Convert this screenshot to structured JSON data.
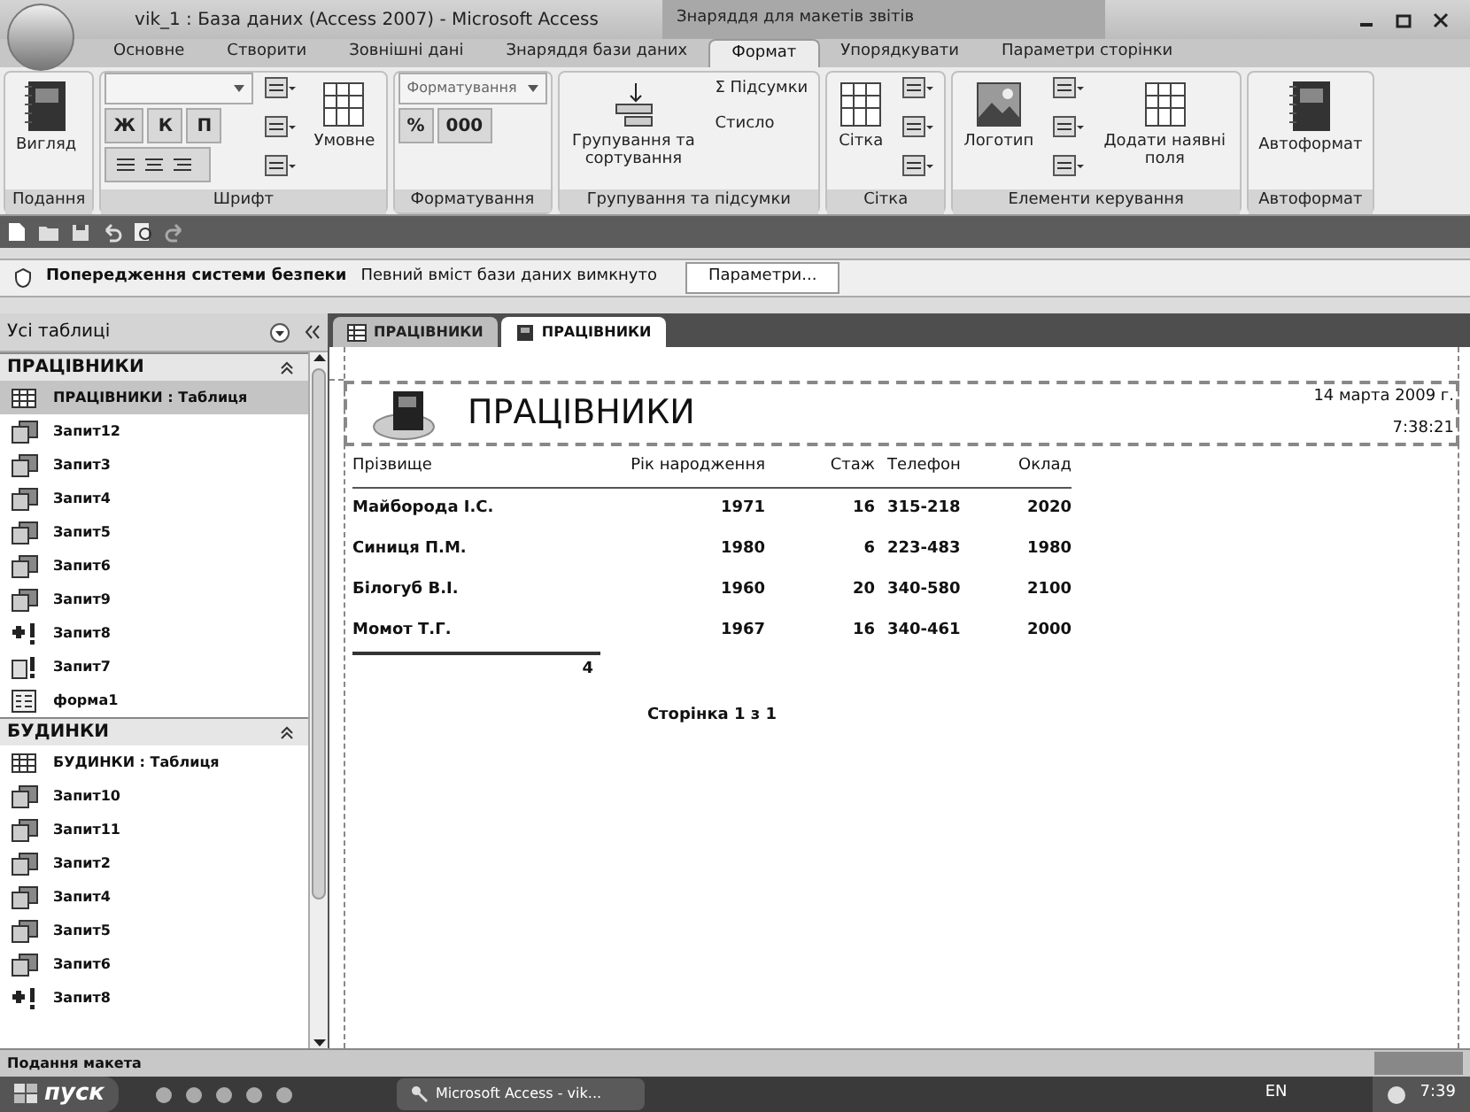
{
  "window": {
    "title": "vik_1 : База даних (Access 2007) - Microsoft Access",
    "context_tab": "Знаряддя для макетів звітів"
  },
  "ribbon_tabs": [
    {
      "label": "Основне",
      "selected": false
    },
    {
      "label": "Створити",
      "selected": false
    },
    {
      "label": "Зовнішні дані",
      "selected": false
    },
    {
      "label": "Знаряддя бази даних",
      "selected": false
    },
    {
      "label": "Формат",
      "selected": true
    },
    {
      "label": "Упорядкувати",
      "selected": false
    },
    {
      "label": "Параметри сторінки",
      "selected": false
    }
  ],
  "ribbon_groups": [
    {
      "label": "Подання",
      "items": [
        {
          "kind": "large",
          "label": "Вигляд"
        }
      ]
    },
    {
      "label": "Шрифт",
      "items": [
        {
          "kind": "combo"
        },
        {
          "kind": "textrow",
          "labels": [
            "Ж",
            "К",
            "П"
          ]
        },
        {
          "kind": "iconrow"
        },
        {
          "kind": "icon"
        },
        {
          "kind": "icon"
        },
        {
          "kind": "icon"
        },
        {
          "kind": "large",
          "label": "Умовне"
        }
      ]
    },
    {
      "label": "Форматування",
      "items": [
        {
          "kind": "combo",
          "placeholder": "Форматування"
        },
        {
          "kind": "textrow",
          "labels": [
            "%",
            "000"
          ]
        }
      ]
    },
    {
      "label": "Групування та підсумки",
      "items": [
        {
          "kind": "large",
          "label": "Групування та сортування"
        },
        {
          "kind": "small",
          "label": "Σ Підсумки"
        },
        {
          "kind": "small",
          "label": "Стисло"
        }
      ]
    },
    {
      "label": "Сітка",
      "items": [
        {
          "kind": "large",
          "label": "Сітка"
        },
        {
          "kind": "icon"
        },
        {
          "kind": "icon"
        },
        {
          "kind": "icon"
        }
      ]
    },
    {
      "label": "Елементи керування",
      "items": [
        {
          "kind": "large",
          "label": "Логотип"
        },
        {
          "kind": "icon"
        },
        {
          "kind": "icon"
        },
        {
          "kind": "icon"
        },
        {
          "kind": "large",
          "label": "Додати наявні поля"
        }
      ]
    },
    {
      "label": "Автоформат",
      "items": [
        {
          "kind": "large",
          "label": "Автоформат"
        }
      ]
    }
  ],
  "security_bar": {
    "title": "Попередження системи безпеки",
    "message": "Певний вміст бази даних вимкнуто",
    "button": "Параметри..."
  },
  "nav_pane": {
    "header": "Усі таблиці",
    "groups": [
      {
        "name": "ПРАЦІВНИКИ",
        "expanded": true,
        "items": [
          {
            "label": "ПРАЦІВНИКИ : Таблиця",
            "kind": "table",
            "selected": true
          },
          {
            "label": "Запит12",
            "kind": "query",
            "selected": false
          },
          {
            "label": "Запит3",
            "kind": "query",
            "selected": false
          },
          {
            "label": "Запит4",
            "kind": "query",
            "selected": false
          },
          {
            "label": "Запит5",
            "kind": "query",
            "selected": false
          },
          {
            "label": "Запит6",
            "kind": "query",
            "selected": false
          },
          {
            "label": "Запит9",
            "kind": "query",
            "selected": false
          },
          {
            "label": "Запит8",
            "kind": "append",
            "selected": false
          },
          {
            "label": "Запит7",
            "kind": "maketable",
            "selected": false
          },
          {
            "label": "форма1",
            "kind": "form",
            "selected": false
          }
        ]
      },
      {
        "name": "БУДИНКИ",
        "expanded": true,
        "items": [
          {
            "label": "БУДИНКИ : Таблиця",
            "kind": "table",
            "selected": false
          },
          {
            "label": "Запит10",
            "kind": "query",
            "selected": false
          },
          {
            "label": "Запит11",
            "kind": "query",
            "selected": false
          },
          {
            "label": "Запит2",
            "kind": "query",
            "selected": false
          },
          {
            "label": "Запит4",
            "kind": "query",
            "selected": false
          },
          {
            "label": "Запит5",
            "kind": "query",
            "selected": false
          },
          {
            "label": "Запит6",
            "kind": "query",
            "selected": false
          },
          {
            "label": "Запит8",
            "kind": "append",
            "selected": false
          }
        ]
      }
    ]
  },
  "doc_tabs": [
    {
      "label": "ПРАЦІВНИКИ",
      "kind": "table",
      "selected": false
    },
    {
      "label": "ПРАЦІВНИКИ",
      "kind": "report",
      "selected": true
    }
  ],
  "report": {
    "title": "ПРАЦІВНИКИ",
    "date": "14 марта 2009 г.",
    "time": "7:38:21",
    "columns": [
      "Прізвище",
      "Рік народження",
      "Стаж",
      "Телефон",
      "Оклад"
    ],
    "rows": [
      [
        "Майборода І.С.",
        "1971",
        "16",
        "315-218",
        "2020"
      ],
      [
        "Синиця П.М.",
        "1980",
        "6",
        "223-483",
        "1980"
      ],
      [
        "Білогуб В.І.",
        "1960",
        "20",
        "340-580",
        "2100"
      ],
      [
        "Момот Т.Г.",
        "1967",
        "16",
        "340-461",
        "2000"
      ]
    ],
    "count": "4",
    "page_footer": "Сторінка 1 з 1"
  },
  "status_bar": {
    "text": "Подання макета"
  },
  "taskbar": {
    "start": "пуск",
    "app_button": "Microsoft Access - vik...",
    "language": "EN",
    "clock": "7:39"
  }
}
